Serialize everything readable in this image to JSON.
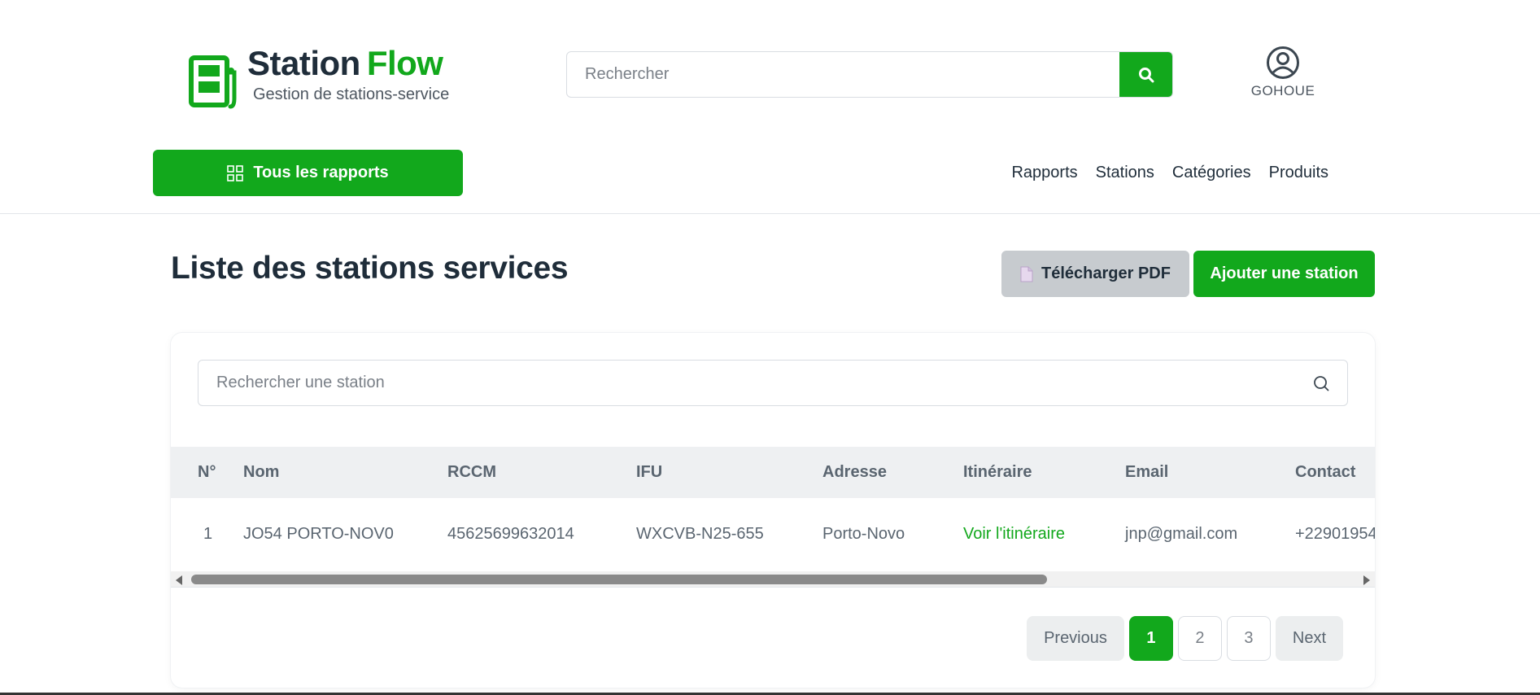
{
  "colors": {
    "accent": "#12a81c",
    "text": "#1f2d3a",
    "muted": "#5a6570",
    "button_grey": "#c7cbcf"
  },
  "header": {
    "brand_part1": "Station",
    "brand_part2": "Flow",
    "tagline": "Gestion de stations-service",
    "search_placeholder": "Rechercher",
    "search_icon": "search-icon",
    "user_icon": "user-circle-icon",
    "user_name": "GOHOUE",
    "all_reports_label": "Tous les rapports",
    "all_reports_icon": "grid-icon",
    "nav": [
      "Rapports",
      "Stations",
      "Catégories",
      "Produits"
    ]
  },
  "main": {
    "title": "Liste des stations services",
    "pdf_button_label": "Télécharger PDF",
    "pdf_icon": "file-icon",
    "add_button_label": "Ajouter une station",
    "table_search_placeholder": "Rechercher une station",
    "table": {
      "columns": [
        "N°",
        "Nom",
        "RCCM",
        "IFU",
        "Adresse",
        "Itinéraire",
        "Email",
        "Contact"
      ],
      "rows": [
        [
          "1",
          "JO54 PORTO-NOV0",
          "45625699632014",
          "WXCVB-N25-655",
          "Porto-Novo",
          "Voir l'itinéraire",
          "jnp@gmail.com",
          "+22901954"
        ]
      ]
    },
    "pagination": {
      "previous": "Previous",
      "pages": [
        "1",
        "2",
        "3"
      ],
      "current": "1",
      "next": "Next"
    }
  }
}
